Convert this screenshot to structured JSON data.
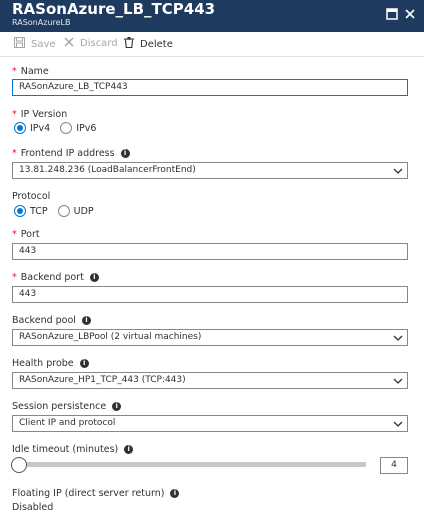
{
  "window": {
    "title": "RASonAzure_LB_TCP443",
    "subtitle": "RASonAzureLB"
  },
  "toolbar": {
    "save_label": "Save",
    "discard_label": "Discard",
    "delete_label": "Delete"
  },
  "form": {
    "name": {
      "label": "Name",
      "value": "RASonAzure_LB_TCP443"
    },
    "ip_version": {
      "label": "IP Version",
      "options": [
        "IPv4",
        "IPv6"
      ],
      "selected": "IPv4"
    },
    "frontend_ip": {
      "label": "Frontend IP address",
      "value": "13.81.248.236 (LoadBalancerFrontEnd)"
    },
    "protocol": {
      "label": "Protocol",
      "options": [
        "TCP",
        "UDP"
      ],
      "selected": "TCP"
    },
    "port": {
      "label": "Port",
      "value": "443"
    },
    "backend_port": {
      "label": "Backend port",
      "value": "443"
    },
    "backend_pool": {
      "label": "Backend pool",
      "value": "RASonAzure_LBPool (2 virtual machines)"
    },
    "health_probe": {
      "label": "Health probe",
      "value": "RASonAzure_HP1_TCP_443 (TCP:443)"
    },
    "session_persistence": {
      "label": "Session persistence",
      "value": "Client IP and protocol"
    },
    "idle_timeout": {
      "label": "Idle timeout (minutes)",
      "value": "4",
      "min": 4,
      "max": 30
    },
    "floating_ip": {
      "label": "Floating IP (direct server return)",
      "value": "Disabled"
    }
  },
  "colors": {
    "titlebar": "#1e3a5f",
    "accent": "#0078d4",
    "required": "#e81123"
  }
}
